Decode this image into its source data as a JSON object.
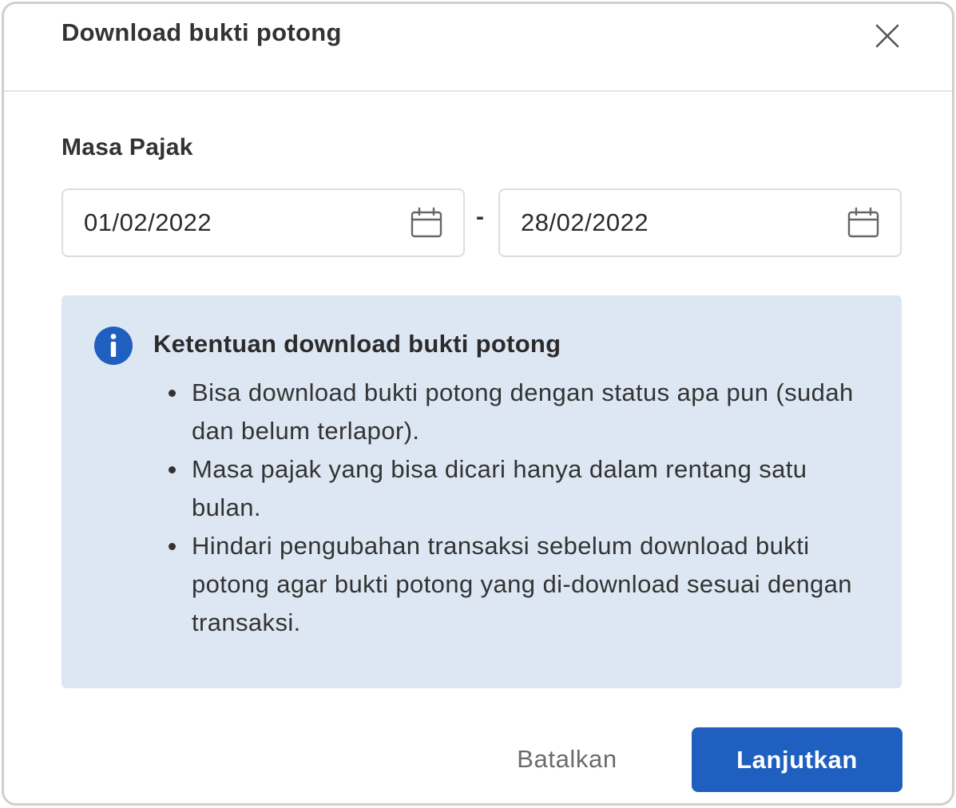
{
  "dialog": {
    "title": "Download bukti potong",
    "close_icon": "close-icon"
  },
  "form": {
    "label": "Masa Pajak",
    "start_date": "01/02/2022",
    "end_date": "28/02/2022",
    "separator": "-",
    "calendar_icon": "calendar-icon"
  },
  "info": {
    "icon": "info-icon",
    "accent_color": "#1f5fbf",
    "background_color": "#dce7f3",
    "title": "Ketentuan download bukti potong",
    "items": [
      "Bisa download bukti potong dengan status apa pun (sudah dan belum terlapor).",
      "Masa pajak yang bisa dicari hanya dalam rentang satu bulan.",
      "Hindari pengubahan transaksi sebelum download bukti potong agar bukti potong yang di-download sesuai dengan transaksi."
    ]
  },
  "actions": {
    "cancel_label": "Batalkan",
    "submit_label": "Lanjutkan",
    "submit_color": "#1f5fbf"
  }
}
